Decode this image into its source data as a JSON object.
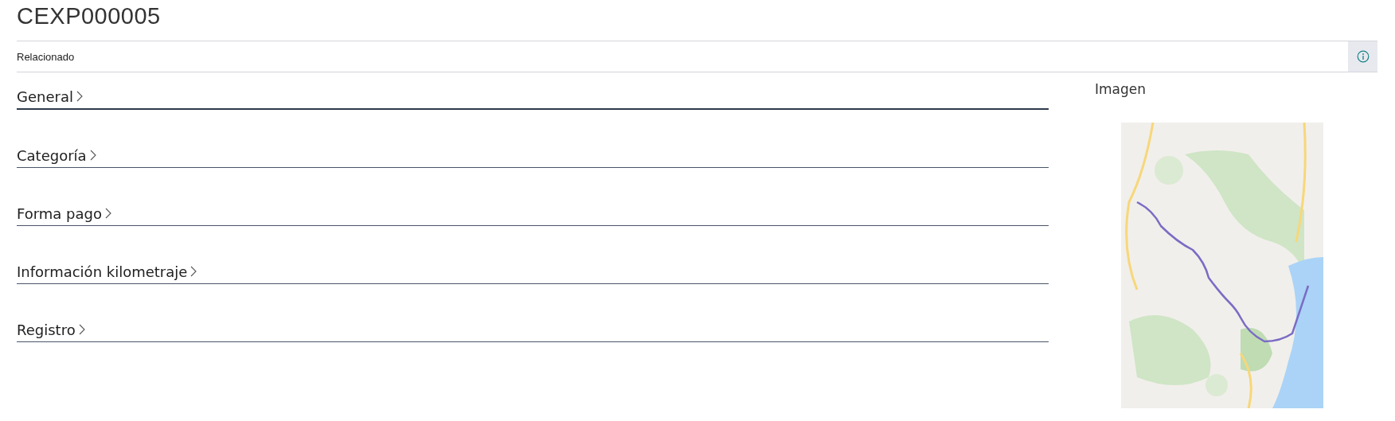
{
  "title": "CEXP000005",
  "action_bar": {
    "items": [
      "Relacionado"
    ]
  },
  "sections": [
    {
      "label": "General",
      "selected": true
    },
    {
      "label": "Categoría",
      "selected": false
    },
    {
      "label": "Forma pago",
      "selected": false
    },
    {
      "label": "Información kilometraje",
      "selected": false
    },
    {
      "label": "Registro",
      "selected": false
    }
  ],
  "factbox": {
    "title": "Imagen"
  }
}
